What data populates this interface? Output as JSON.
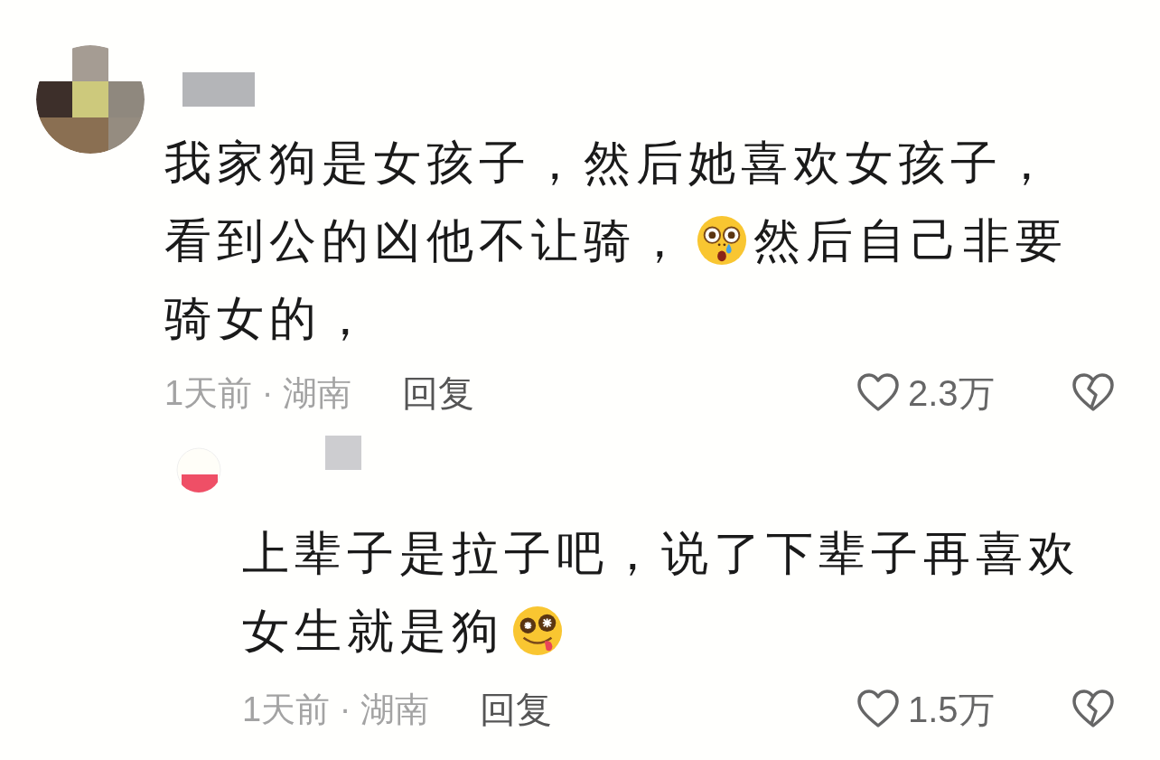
{
  "comments": [
    {
      "lines": [
        [
          {
            "kind": "text",
            "text": "我家狗是女孩子，然后她喜欢女孩子，"
          }
        ],
        [
          {
            "kind": "text",
            "text": "看到公的凶他不让骑，"
          },
          {
            "kind": "shocked"
          },
          {
            "kind": "text",
            "text": "然后自己非要"
          }
        ],
        [
          {
            "kind": "text",
            "text": "骑女的，"
          }
        ]
      ],
      "meta": "1天前 · 湖南",
      "reply_label": "回复",
      "likes": "2.3万",
      "replies": [
        {
          "lines": [
            [
              {
                "kind": "text",
                "text": "上辈子是拉子吧，说了下辈子再喜欢"
              }
            ],
            [
              {
                "kind": "text",
                "text": "女生就是狗"
              },
              {
                "kind": "dazed"
              }
            ]
          ],
          "meta": "1天前 · 湖南",
          "reply_label": "回复",
          "likes": "1.5万"
        }
      ]
    }
  ]
}
